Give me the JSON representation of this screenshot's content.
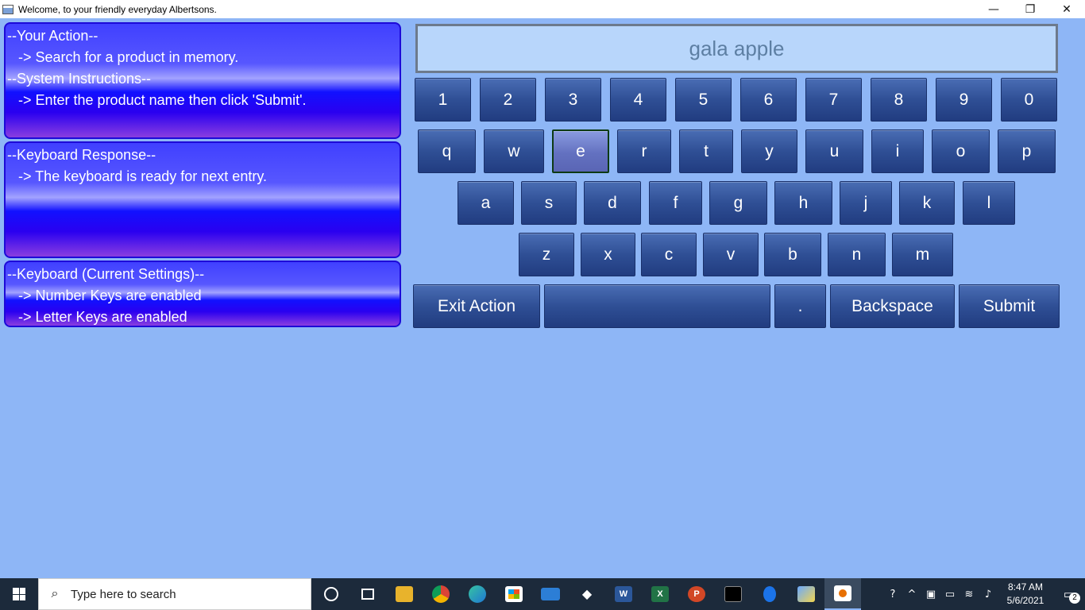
{
  "window": {
    "title": "Welcome, to your friendly everyday Albertsons.",
    "minimize": "—",
    "restore": "❐",
    "close": "✕"
  },
  "panels": {
    "action": {
      "line1": "--Your Action--",
      "line2": "-> Search for a product in memory.",
      "line3": "--System Instructions--",
      "line4": "-> Enter the product name then click 'Submit'."
    },
    "response": {
      "line1": "--Keyboard Response--",
      "line2": "-> The keyboard is ready for next entry."
    },
    "settings": {
      "line1": "--Keyboard (Current Settings)--",
      "line2": "-> Number Keys are enabled",
      "line3": "-> Letter Keys are enabled"
    }
  },
  "display": {
    "value": "gala apple"
  },
  "keys": {
    "numbers": [
      "1",
      "2",
      "3",
      "4",
      "5",
      "6",
      "7",
      "8",
      "9",
      "0"
    ],
    "row1": [
      "q",
      "w",
      "e",
      "r",
      "t",
      "y",
      "u",
      "i",
      "o",
      "p"
    ],
    "row2": [
      "a",
      "s",
      "d",
      "f",
      "g",
      "h",
      "j",
      "k",
      "l"
    ],
    "row3": [
      "z",
      "x",
      "c",
      "v",
      "b",
      "n",
      "m"
    ],
    "actions": {
      "exit": "Exit Action",
      "space": "",
      "period": ".",
      "backspace": "Backspace",
      "submit": "Submit"
    },
    "selected": "e"
  },
  "taskbar": {
    "search_placeholder": "Type here to search",
    "icons": [
      "cortana-icon",
      "task-view-icon",
      "file-explorer-icon",
      "chrome-icon",
      "edge-icon",
      "store-icon",
      "mail-icon",
      "dropbox-icon",
      "word-icon",
      "excel-icon",
      "powerpoint-icon",
      "terminal-icon",
      "bluetooth-icon",
      "virtualbox-icon",
      "java-icon"
    ],
    "word_label": "W",
    "excel_label": "X",
    "powerpoint_label": "P",
    "clock_time": "8:47 AM",
    "clock_date": "5/6/2021",
    "notification_count": "2"
  },
  "colors": {
    "background": "#8eb6f6",
    "key": "#2f4f95",
    "key_selected": "#6371c0",
    "panel": "#1111ff"
  }
}
